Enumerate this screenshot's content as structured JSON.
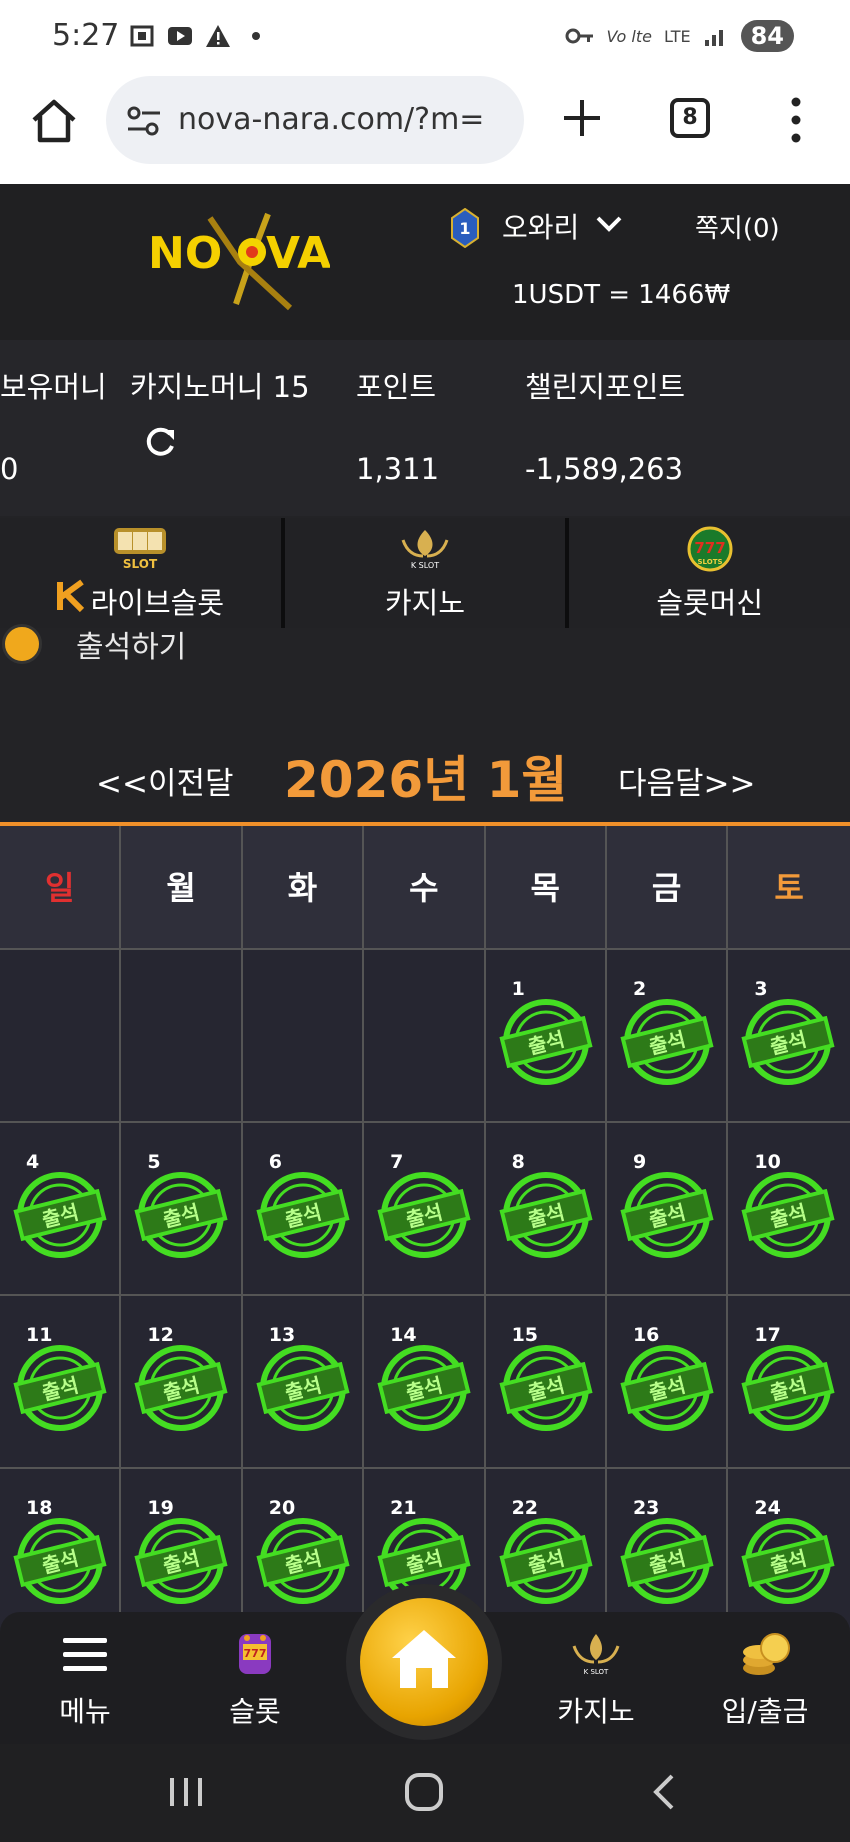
{
  "status_bar": {
    "time": "5:27",
    "battery": "84",
    "network": "LTE"
  },
  "browser": {
    "url": "nova-nara.com/?m=",
    "tab_count": "8"
  },
  "header": {
    "logo_text": "NOVA",
    "level": "1",
    "user_name": "오와리",
    "messages": "쪽지(0)",
    "rate": "1USDT = 1466₩"
  },
  "balances": {
    "items": [
      {
        "label": "보유머니",
        "value": "0"
      },
      {
        "label": "카지노머니 15",
        "value": ""
      },
      {
        "label": "포인트",
        "value": "1,311"
      },
      {
        "label": "챌린지포인트",
        "value": "-1,589,263"
      }
    ]
  },
  "game_tabs": [
    {
      "label": "라이브슬롯",
      "icon": "live-slot-icon"
    },
    {
      "label": "카지노",
      "icon": "k-slot-icon"
    },
    {
      "label": "슬롯머신",
      "icon": "777-slots-icon"
    }
  ],
  "attendance": {
    "title": "출석하기",
    "prev": "<<이전달",
    "next": "다음달>>",
    "month_title": "2026년 1월",
    "weekdays": [
      "일",
      "월",
      "화",
      "수",
      "목",
      "금",
      "토"
    ],
    "stamp_label": "출석",
    "weeks": [
      [
        "",
        "",
        "",
        "",
        "1",
        "2",
        "3"
      ],
      [
        "4",
        "5",
        "6",
        "7",
        "8",
        "9",
        "10"
      ],
      [
        "11",
        "12",
        "13",
        "14",
        "15",
        "16",
        "17"
      ],
      [
        "18",
        "19",
        "20",
        "21",
        "22",
        "23",
        "24"
      ]
    ]
  },
  "bottom_nav": {
    "menu": "메뉴",
    "slot": "슬롯",
    "casino": "카지노",
    "deposit": "입/출금"
  },
  "colors": {
    "accent": "#f29a3a",
    "stamp": "#44dd22",
    "sunday": "#e03030",
    "saturday": "#f29a3a"
  }
}
